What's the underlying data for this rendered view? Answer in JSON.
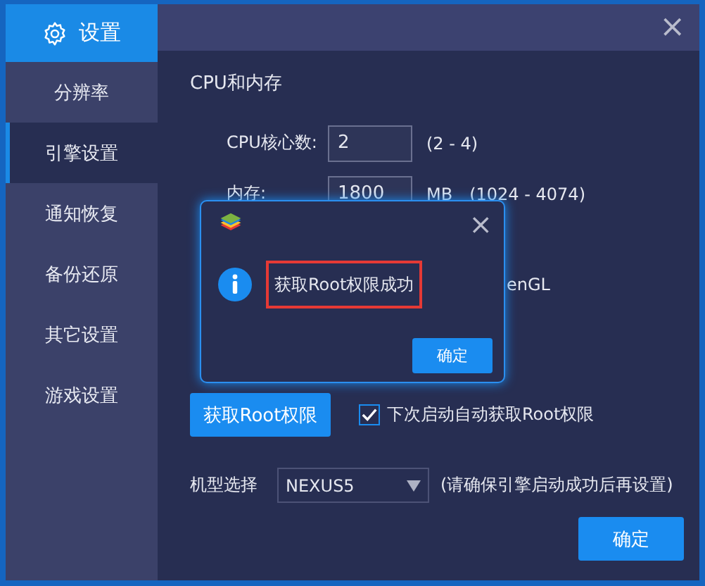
{
  "sidebar": {
    "title": "设置",
    "items": [
      {
        "label": "分辨率",
        "selected": false
      },
      {
        "label": "引擎设置",
        "selected": true
      },
      {
        "label": "通知恢复",
        "selected": false
      },
      {
        "label": "备份还原",
        "selected": false
      },
      {
        "label": "其它设置",
        "selected": false
      },
      {
        "label": "游戏设置",
        "selected": false
      }
    ]
  },
  "close": "×",
  "section_title": "CPU和内存",
  "cpu": {
    "label": "CPU核心数:",
    "value": "2",
    "range": "(2 - 4)"
  },
  "memory": {
    "label": "内存:",
    "value": "1800",
    "unit": "MB",
    "range": "(1024 - 4074)"
  },
  "hidden_text": "enGL",
  "root_button": "获取Root权限",
  "auto_root": {
    "label": "下次启动自动获取Root权限",
    "checked": true
  },
  "model": {
    "label": "机型选择",
    "value": "NEXUS5",
    "note": "(请确保引擎启动成功后再设置)"
  },
  "confirm": "确定",
  "dialog": {
    "close": "×",
    "message": "获取Root权限成功",
    "ok": "确定"
  }
}
